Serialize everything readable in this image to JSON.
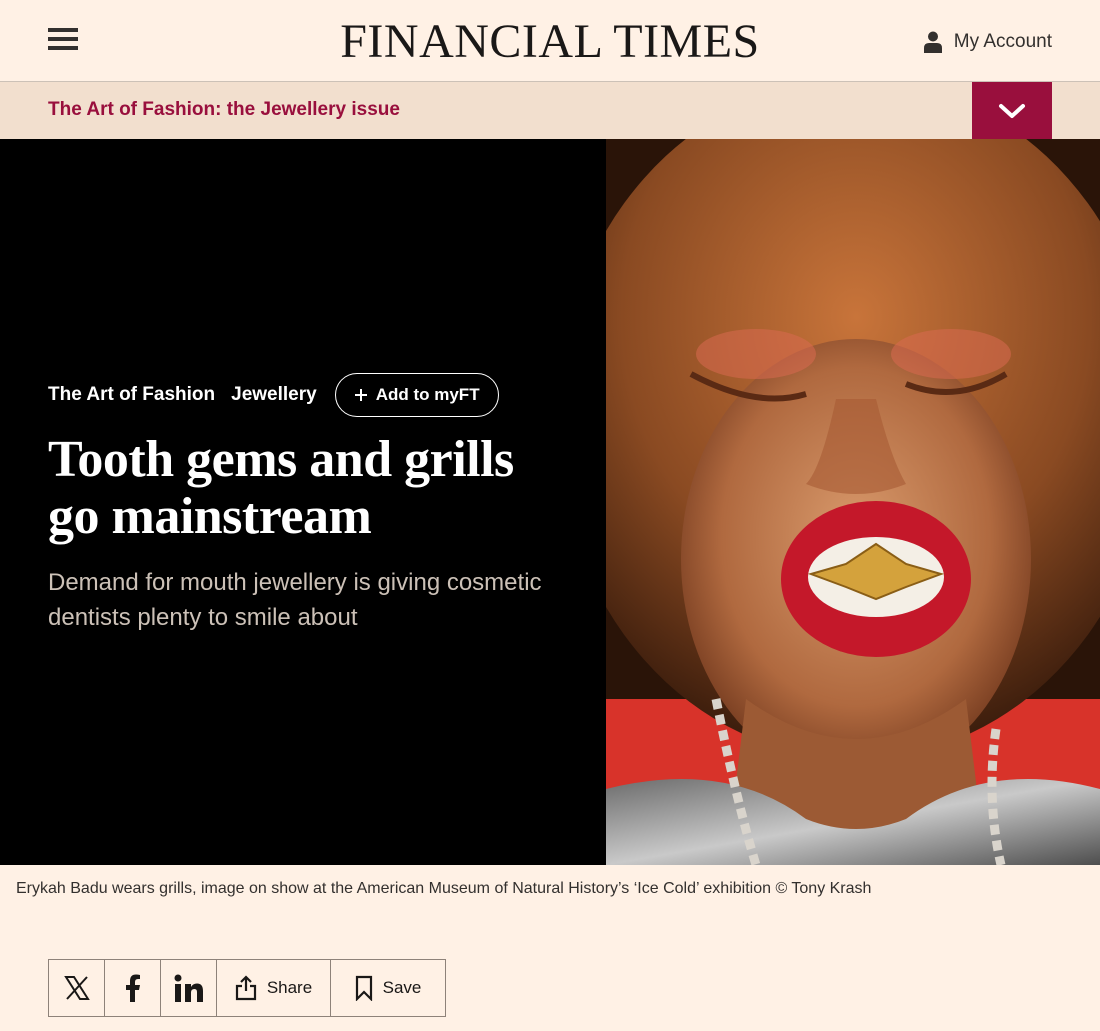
{
  "header": {
    "masthead": "FINANCIAL TIMES",
    "account_label": "My Account"
  },
  "series": {
    "title": "The Art of Fashion: the Jewellery issue"
  },
  "article": {
    "tags": [
      "The Art of Fashion",
      "Jewellery"
    ],
    "myft_label": "Add to myFT",
    "headline": "Tooth gems and grills go mainstream",
    "standfirst": "Demand for mouth jewellery is giving cosmetic dentists plenty to smile about",
    "caption": "Erykah Badu wears grills, image on show at the American Museum of Natural History’s ‘Ice Cold’ exhibition © Tony Krash"
  },
  "share": {
    "share_label": "Share",
    "save_label": "Save"
  },
  "colors": {
    "background": "#fff1e5",
    "accent": "#990f3d",
    "series_bar": "#f2dfce",
    "hero_bg": "#000000"
  },
  "icons": [
    "menu-icon",
    "user-icon",
    "chevron-down-icon",
    "plus-icon",
    "x-icon",
    "facebook-icon",
    "linkedin-icon",
    "share-icon",
    "bookmark-icon"
  ]
}
